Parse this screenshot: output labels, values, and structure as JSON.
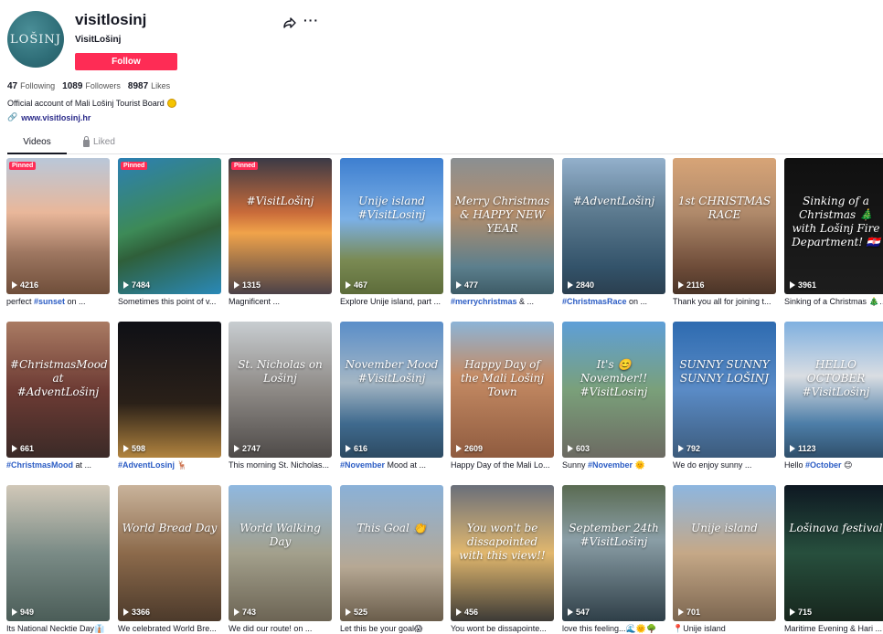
{
  "profile": {
    "avatar_text": "LOŠINJ",
    "username": "visitlosinj",
    "nickname": "VisitLošinj",
    "follow_label": "Follow",
    "following_count": "47",
    "following_label": "Following",
    "followers_count": "1089",
    "followers_label": "Followers",
    "likes_count": "8987",
    "likes_label": "Likes",
    "bio": "Official account of Mali Lošinj Tourist Board",
    "link": "www.visitlosinj.hr"
  },
  "tabs": {
    "videos": "Videos",
    "liked": "Liked"
  },
  "videos": [
    {
      "views": "4216",
      "pinned": "Pinned",
      "overlay": "",
      "cap_pre": "perfect ",
      "tag": "#sunset",
      "cap_post": " on ..."
    },
    {
      "views": "7484",
      "pinned": "Pinned",
      "overlay": "",
      "cap_pre": "Sometimes this point of v...",
      "tag": "",
      "cap_post": ""
    },
    {
      "views": "1315",
      "pinned": "Pinned",
      "overlay": "#VisitLošinj",
      "cap_pre": "Magnificent ...",
      "tag": "",
      "cap_post": ""
    },
    {
      "views": "467",
      "pinned": "",
      "overlay": "Unije island #VisitLosinj",
      "cap_pre": "Explore Unije island, part ...",
      "tag": "",
      "cap_post": ""
    },
    {
      "views": "477",
      "pinned": "",
      "overlay": "Merry Christmas & HAPPY NEW YEAR",
      "cap_pre": "",
      "tag": "#merrychristmas",
      "cap_post": " & ..."
    },
    {
      "views": "2840",
      "pinned": "",
      "overlay": "#AdventLošinj",
      "cap_pre": "",
      "tag": "#ChristmasRace",
      "cap_post": " on ..."
    },
    {
      "views": "2116",
      "pinned": "",
      "overlay": "1st CHRISTMAS RACE",
      "cap_pre": "Thank you all for joining t...",
      "tag": "",
      "cap_post": ""
    },
    {
      "views": "3961",
      "pinned": "",
      "overlay": "Sinking of a Christmas 🎄 with Lošinj Fire Department! 🇭🇷",
      "cap_pre": "Sinking of a Christmas 🎄 ...",
      "tag": "",
      "cap_post": ""
    },
    {
      "views": "661",
      "pinned": "",
      "overlay": "#ChristmasMood at #AdventLošinj",
      "cap_pre": "",
      "tag": "#ChristmasMood",
      "cap_post": " at ..."
    },
    {
      "views": "598",
      "pinned": "",
      "overlay": "",
      "cap_pre": "",
      "tag": "#AdventLosinj",
      "cap_post": " 🦌"
    },
    {
      "views": "2747",
      "pinned": "",
      "overlay": "St. Nicholas on Lošinj",
      "cap_pre": "This morning St. Nicholas...",
      "tag": "",
      "cap_post": ""
    },
    {
      "views": "616",
      "pinned": "",
      "overlay": "November Mood #VisitLošinj",
      "cap_pre": "",
      "tag": "#November",
      "cap_post": " Mood at ..."
    },
    {
      "views": "2609",
      "pinned": "",
      "overlay": "Happy Day of the Mali Lošinj Town",
      "cap_pre": "Happy Day of the Mali Lo...",
      "tag": "",
      "cap_post": ""
    },
    {
      "views": "603",
      "pinned": "",
      "overlay": "It's 😊 November!! #VisitLosinj",
      "cap_pre": "Sunny ",
      "tag": "#November",
      "cap_post": " 🌞"
    },
    {
      "views": "792",
      "pinned": "",
      "overlay": "SUNNY SUNNY SUNNY LOŠINJ",
      "cap_pre": "We do enjoy sunny ...",
      "tag": "",
      "cap_post": ""
    },
    {
      "views": "1123",
      "pinned": "",
      "overlay": "HELLO OCTOBER #VisitLošinj",
      "cap_pre": "Hello ",
      "tag": "#October",
      "cap_post": " 😊"
    },
    {
      "views": "949",
      "pinned": "",
      "overlay": "",
      "cap_pre": "Its National Necktie Day👔",
      "tag": "",
      "cap_post": ""
    },
    {
      "views": "3366",
      "pinned": "",
      "overlay": "World Bread Day",
      "cap_pre": "We celebrated World Bre...",
      "tag": "",
      "cap_post": ""
    },
    {
      "views": "743",
      "pinned": "",
      "overlay": "World Walking Day",
      "cap_pre": "We did our route! on ...",
      "tag": "",
      "cap_post": ""
    },
    {
      "views": "525",
      "pinned": "",
      "overlay": "This Goal 👏",
      "cap_pre": "Let this be your goal😱",
      "tag": "",
      "cap_post": ""
    },
    {
      "views": "456",
      "pinned": "",
      "overlay": "You won't be dissapointed with this view!!",
      "cap_pre": "You wont be dissapointe...",
      "tag": "",
      "cap_post": ""
    },
    {
      "views": "547",
      "pinned": "",
      "overlay": "September 24th #VisitLošinj",
      "cap_pre": "love this feeling...🌊🌞🌳",
      "tag": "",
      "cap_post": ""
    },
    {
      "views": "701",
      "pinned": "",
      "overlay": "Unije island",
      "cap_pre": "📍Unije island",
      "tag": "",
      "cap_post": ""
    },
    {
      "views": "715",
      "pinned": "",
      "overlay": "Lošinava festival",
      "cap_pre": "Maritime Evening & Hari ...",
      "tag": "",
      "cap_post": ""
    }
  ]
}
